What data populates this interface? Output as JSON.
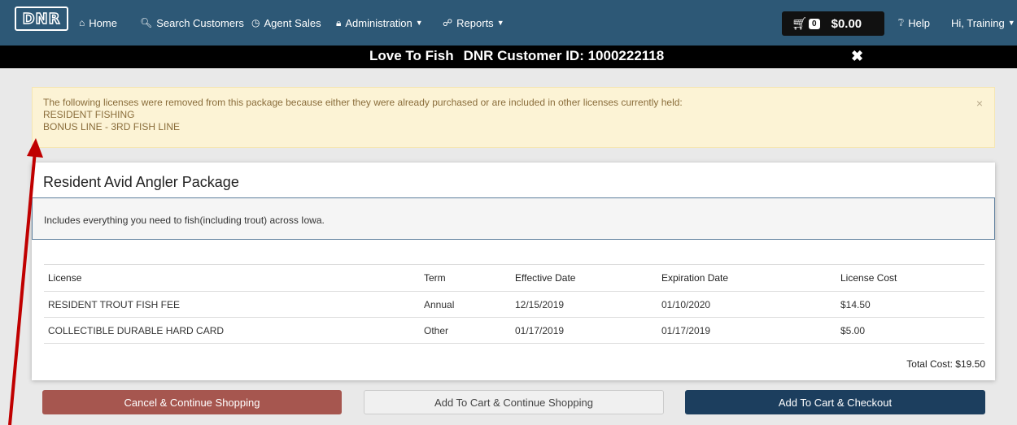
{
  "nav": {
    "logo_text": "DNR",
    "home": "Home",
    "search_customers": "Search Customers",
    "agent_sales": "Agent Sales",
    "administration": "Administration",
    "reports": "Reports",
    "cart_count": "0",
    "cart_total": "$0.00",
    "help": "Help",
    "user": "Hi, Training"
  },
  "titlebar": {
    "name": "Love To Fish",
    "customer_id": "DNR Customer ID: 1000222118"
  },
  "alert": {
    "message": "The following licenses were removed from this package because either they were already purchased or are included in other licenses currently held:",
    "items": [
      "RESIDENT FISHING",
      "BONUS LINE - 3RD FISH LINE"
    ]
  },
  "package": {
    "title": "Resident Avid Angler Package",
    "description": "Includes everything you need to fish(including trout) across Iowa.",
    "columns": [
      "License",
      "Term",
      "Effective Date",
      "Expiration Date",
      "License Cost"
    ],
    "rows": [
      [
        "RESIDENT TROUT FISH FEE",
        "Annual",
        "12/15/2019",
        "01/10/2020",
        "$14.50"
      ],
      [
        "COLLECTIBLE DURABLE HARD CARD",
        "Other",
        "01/17/2019",
        "01/17/2019",
        "$5.00"
      ]
    ],
    "total": "Total Cost: $19.50"
  },
  "buttons": {
    "cancel": "Cancel & Continue Shopping",
    "add_continue": "Add To Cart & Continue Shopping",
    "add_checkout": "Add To Cart & Checkout"
  },
  "colors": {
    "nav": "#2d5876",
    "alert_bg": "#fcf3d5",
    "cancel": "#a6564f",
    "checkout": "#1c3e5e",
    "annotation_arrow": "#c00000"
  }
}
